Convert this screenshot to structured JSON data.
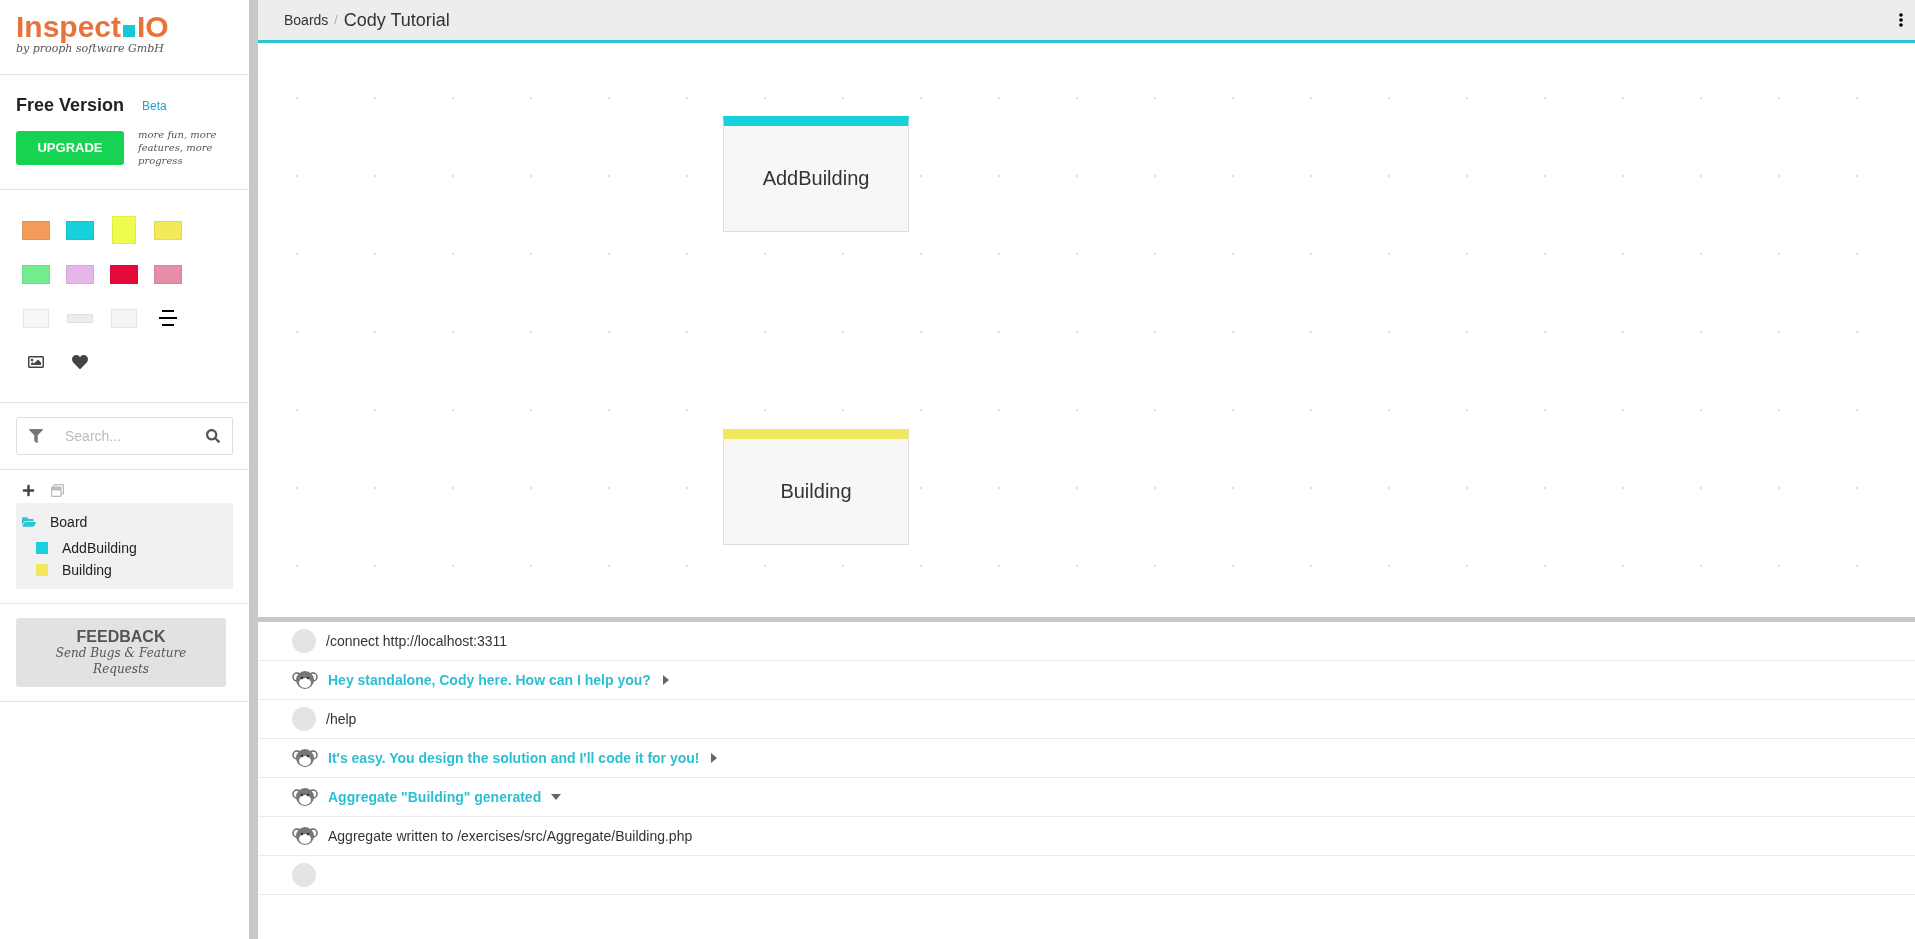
{
  "logo": {
    "title": "Inspect",
    "title_end": "IO",
    "subtitle": "by prooph software GmbH"
  },
  "plan": {
    "name": "Free Version",
    "badge": "Beta",
    "upgrade_button": "UPGRADE",
    "tagline": "more fun, more features, more progress"
  },
  "palette": [
    {
      "kind": "sticky",
      "color": "#f39c5a"
    },
    {
      "kind": "sticky",
      "color": "#16d1dc"
    },
    {
      "kind": "tall",
      "color": "#eefc4e"
    },
    {
      "kind": "sticky",
      "color": "#f2ea5a"
    },
    {
      "kind": "sticky",
      "color": "#72ec8f"
    },
    {
      "kind": "sticky",
      "color": "#e6b5e9"
    },
    {
      "kind": "sticky",
      "color": "#e60a3a"
    },
    {
      "kind": "sticky",
      "color": "#e68da8"
    },
    {
      "kind": "flat",
      "color": "#f7f7f7"
    },
    {
      "kind": "bar",
      "color": "#ececec"
    },
    {
      "kind": "flat",
      "color": "#f4f4f4"
    }
  ],
  "search": {
    "placeholder": "Search..."
  },
  "tree": [
    {
      "label": "Board",
      "expanded": true,
      "children": [
        {
          "label": "AddBuilding",
          "color": "#1ccfdd"
        },
        {
          "label": "Building",
          "color": "#f0e960"
        }
      ]
    }
  ],
  "feedback": {
    "title": "FEEDBACK",
    "subtitle": "Send Bugs & Feature Requests"
  },
  "breadcrumb": {
    "parent": "Boards",
    "separator": "/",
    "current": "Cody Tutorial"
  },
  "canvas": {
    "cards": [
      {
        "label": "AddBuilding",
        "color": "#16d1dc"
      },
      {
        "label": "Building",
        "color": "#f0e960"
      }
    ]
  },
  "chat": [
    {
      "kind": "user",
      "text": "/connect http://localhost:3311"
    },
    {
      "kind": "bot-reply",
      "text": "Hey standalone, Cody here. How can I help you?",
      "expanded": false
    },
    {
      "kind": "user",
      "text": "/help"
    },
    {
      "kind": "bot-reply",
      "text": "It's easy. You design the solution and I'll code it for you!",
      "expanded": false
    },
    {
      "kind": "bot-reply",
      "text": "Aggregate \"Building\" generated",
      "expanded": true
    },
    {
      "kind": "bot-note",
      "text": "Aggregate written to /exercises/src/Aggregate/Building.php"
    },
    {
      "kind": "user"
    }
  ]
}
